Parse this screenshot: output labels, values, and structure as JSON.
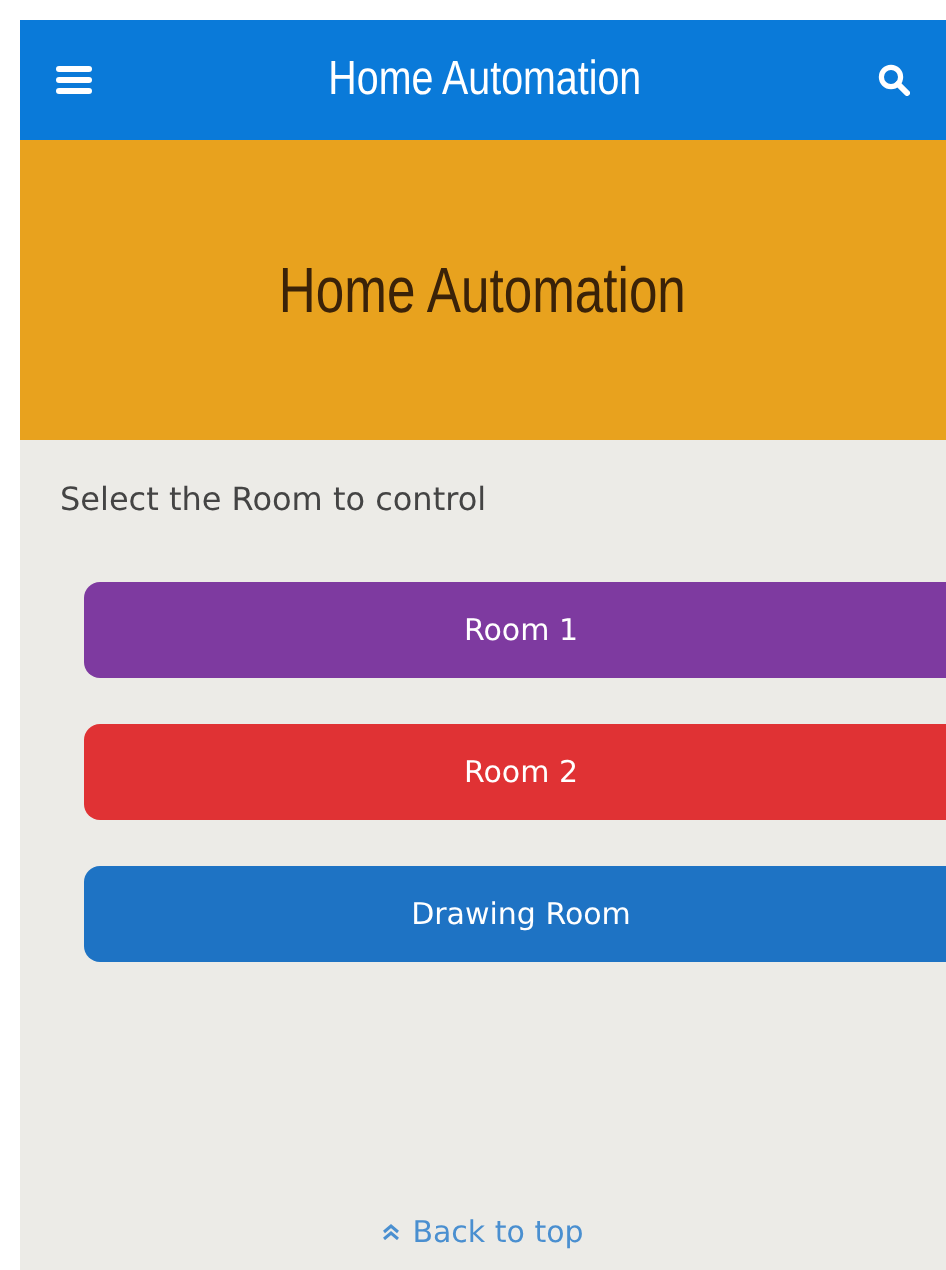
{
  "app_bar": {
    "title": "Home Automation"
  },
  "banner": {
    "title": "Home Automation"
  },
  "prompt": "Select the Room to control",
  "rooms": [
    {
      "label": "Room 1",
      "color": "#7e3aa0"
    },
    {
      "label": "Room 2",
      "color": "#e03234"
    },
    {
      "label": "Drawing Room",
      "color": "#1e73c4"
    }
  ],
  "back_to_top": "Back to top"
}
